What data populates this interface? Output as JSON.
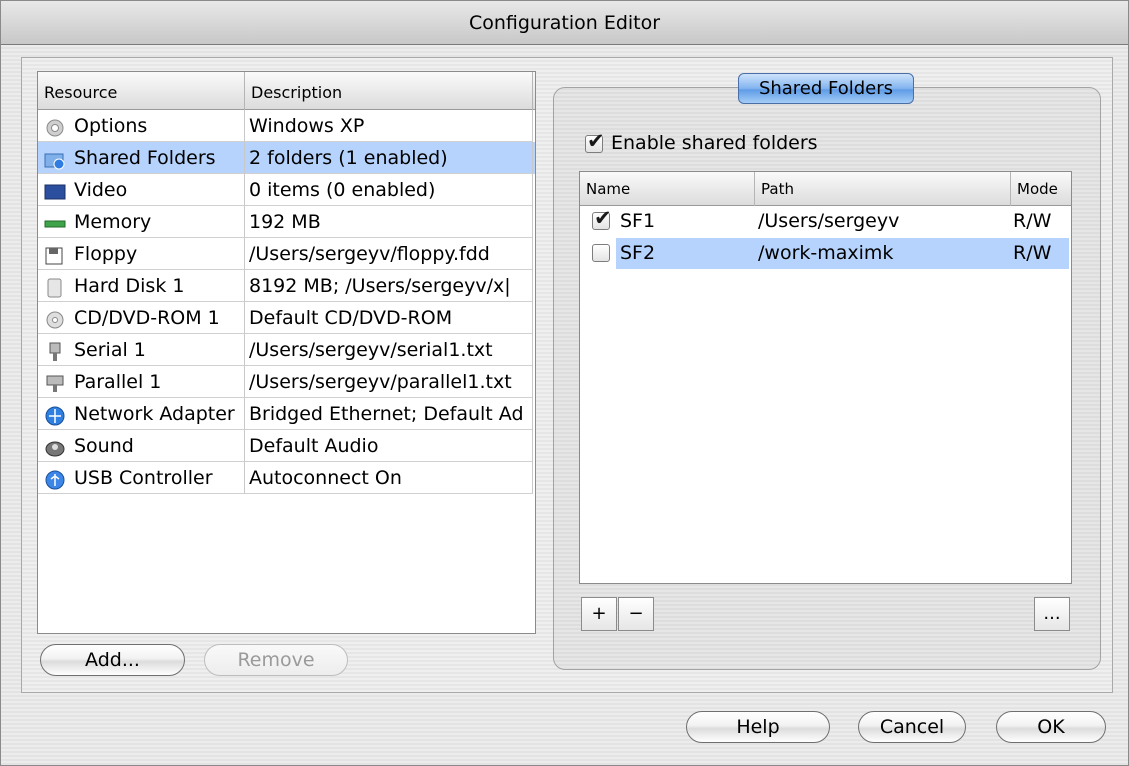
{
  "window": {
    "title": "Configuration Editor"
  },
  "resources": {
    "headers": [
      "Resource",
      "Description"
    ],
    "rows": [
      {
        "name": "Options",
        "description": "Windows XP",
        "icon": "gear-icon",
        "selected": false
      },
      {
        "name": "Shared Folders",
        "description": "2 folders (1 enabled)",
        "icon": "shared-folder-icon",
        "selected": true
      },
      {
        "name": "Video",
        "description": "0 items (0 enabled)",
        "icon": "video-icon",
        "selected": false
      },
      {
        "name": "Memory",
        "description": "192 MB",
        "icon": "memory-icon",
        "selected": false
      },
      {
        "name": "Floppy",
        "description": "/Users/sergeyv/floppy.fdd",
        "icon": "floppy-icon",
        "selected": false
      },
      {
        "name": "Hard Disk 1",
        "description": "8192 MB; /Users/sergeyv/x|",
        "icon": "hard-disk-icon",
        "selected": false
      },
      {
        "name": "CD/DVD-ROM 1",
        "description": "Default CD/DVD-ROM",
        "icon": "cd-icon",
        "selected": false
      },
      {
        "name": "Serial 1",
        "description": "/Users/sergeyv/serial1.txt",
        "icon": "serial-port-icon",
        "selected": false
      },
      {
        "name": "Parallel 1",
        "description": "/Users/sergeyv/parallel1.txt",
        "icon": "parallel-port-icon",
        "selected": false
      },
      {
        "name": "Network Adapter",
        "description": "Bridged Ethernet; Default Ad",
        "icon": "network-icon",
        "selected": false
      },
      {
        "name": "Sound",
        "description": "Default Audio",
        "icon": "sound-icon",
        "selected": false
      },
      {
        "name": "USB Controller",
        "description": "Autoconnect On",
        "icon": "usb-icon",
        "selected": false
      }
    ],
    "add_label": "Add...",
    "remove_label": "Remove"
  },
  "shared_folders": {
    "group_title": "Shared Folders",
    "enable_label": "Enable shared folders",
    "enable_checked": true,
    "headers": [
      "Name",
      "Path",
      "Mode"
    ],
    "rows": [
      {
        "name": "SF1",
        "path": "/Users/sergeyv",
        "mode": "R/W",
        "enabled": true,
        "selected": false
      },
      {
        "name": "SF2",
        "path": "/work-maximk",
        "mode": "R/W",
        "enabled": false,
        "selected": true
      }
    ],
    "add_symbol": "+",
    "remove_symbol": "−",
    "more_symbol": "..."
  },
  "footer": {
    "help_label": "Help",
    "cancel_label": "Cancel",
    "ok_label": "OK"
  }
}
